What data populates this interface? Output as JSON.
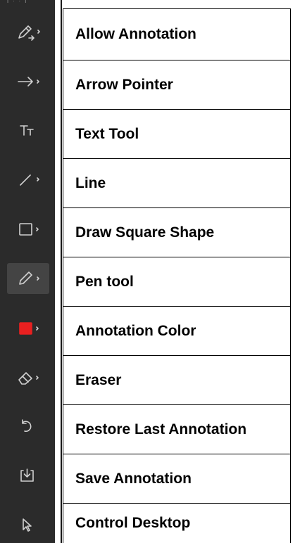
{
  "top_hint": "I · · I",
  "tools": [
    {
      "label": "Allow Annotation",
      "icon": "annotation-pen-icon",
      "has_submenu": true
    },
    {
      "label": "Arrow Pointer",
      "icon": "arrow-right-icon",
      "has_submenu": true
    },
    {
      "label": "Text Tool",
      "icon": "text-tool-icon",
      "has_submenu": false
    },
    {
      "label": "Line",
      "icon": "line-icon",
      "has_submenu": true
    },
    {
      "label": "Draw Square Shape",
      "icon": "square-icon",
      "has_submenu": true
    },
    {
      "label": "Pen tool",
      "icon": "pen-icon",
      "has_submenu": true,
      "active": true
    },
    {
      "label": "Annotation Color",
      "icon": "color-swatch-icon",
      "has_submenu": true,
      "color": "#e82020"
    },
    {
      "label": "Eraser",
      "icon": "eraser-icon",
      "has_submenu": true
    },
    {
      "label": "Restore Last Annotation",
      "icon": "undo-icon",
      "has_submenu": false
    },
    {
      "label": "Save Annotation",
      "icon": "save-download-icon",
      "has_submenu": false
    },
    {
      "label": "Control Desktop",
      "icon": "cursor-pointer-icon",
      "has_submenu": false
    }
  ],
  "colors": {
    "toolbar_bg": "#2b2b2b",
    "icon": "#d0d0d0",
    "active_bg": "#444444",
    "annotation_color": "#e82020"
  }
}
